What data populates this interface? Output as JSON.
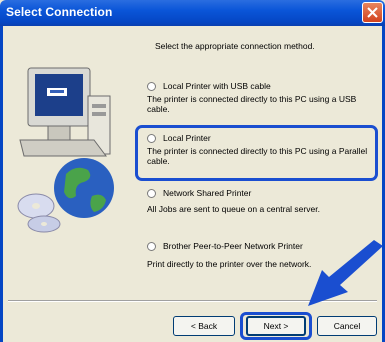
{
  "window": {
    "title": "Select Connection"
  },
  "instruction": "Select the appropriate connection method.",
  "options": [
    {
      "label": "Local Printer with USB cable",
      "desc1": "The printer is connected directly to this PC using a USB",
      "desc2": "cable."
    },
    {
      "label": "Local Printer",
      "desc1": "The printer is connected directly to this PC using a Parallel",
      "desc2": "cable."
    },
    {
      "label": "Network Shared Printer",
      "desc1": "All Jobs are sent to queue on a central server.",
      "desc2": ""
    },
    {
      "label": "Brother Peer-to-Peer Network Printer",
      "desc1": "Print directly to the printer over the network.",
      "desc2": ""
    }
  ],
  "buttons": {
    "back": "< Back",
    "next": "Next >",
    "cancel": "Cancel"
  },
  "colors": {
    "highlight": "#1a4ed0",
    "titlebar": "#0546c4"
  }
}
